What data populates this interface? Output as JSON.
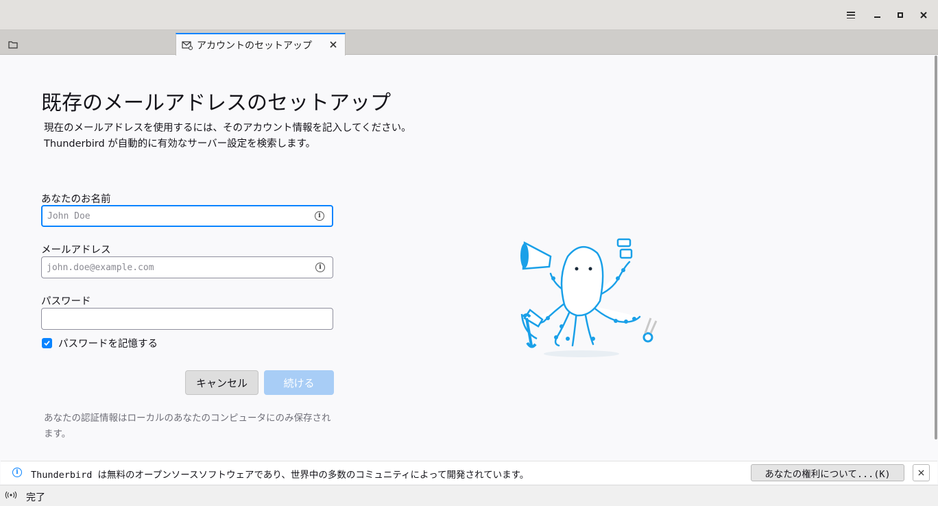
{
  "tab": {
    "title": "アカウントのセットアップ"
  },
  "page": {
    "title": "既存のメールアドレスのセットアップ",
    "description_line1": "現在のメールアドレスを使用するには、そのアカウント情報を記入してください。",
    "description_line2": "Thunderbird が自動的に有効なサーバー設定を検索します。"
  },
  "form": {
    "name_label": "あなたのお名前",
    "name_placeholder": "John Doe",
    "name_value": "",
    "email_label": "メールアドレス",
    "email_placeholder": "john.doe@example.com",
    "email_value": "",
    "password_label": "パスワード",
    "password_value": "",
    "remember_label": "パスワードを記憶する",
    "remember_checked": true
  },
  "buttons": {
    "cancel": "キャンセル",
    "continue": "続ける"
  },
  "privacy_note": "あなたの認証情報はローカルのあなたのコンピュータにのみ保存されます。",
  "notification": {
    "text": "Thunderbird は無料のオープンソースソフトウェアであり、世界中の多数のコミュニティによって開発されています。",
    "button": "あなたの権利について...(K)"
  },
  "status": {
    "text": "完了"
  },
  "colors": {
    "accent": "#0a84ff",
    "mascot_blue": "#1aa0e8"
  },
  "icons": [
    "menu-icon",
    "minimize-icon",
    "maximize-icon",
    "close-icon",
    "folder-icon",
    "mail-setup-icon",
    "info-icon",
    "checkbox-check-icon",
    "broadcast-icon"
  ]
}
